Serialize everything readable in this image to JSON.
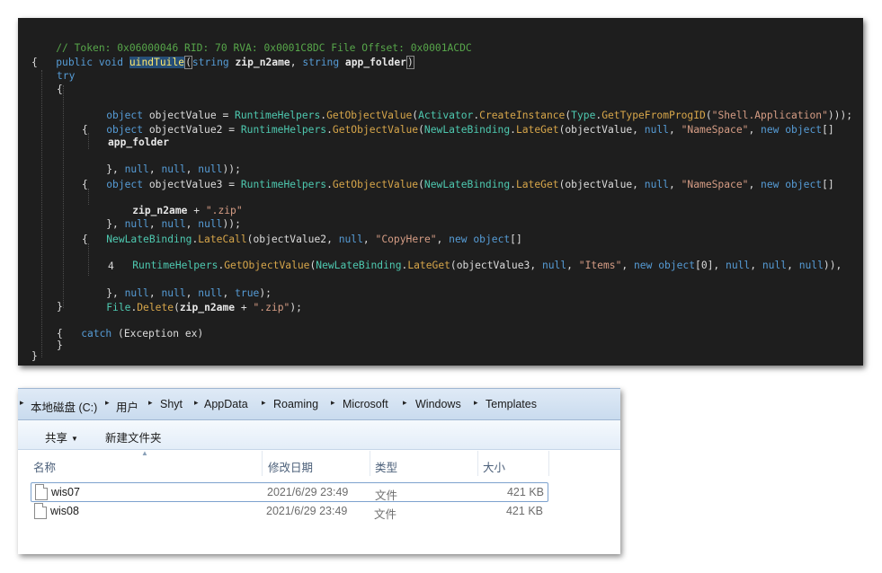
{
  "code": {
    "comment": "// Token: 0x06000046 RID: 70 RVA: 0x0001C8DC File Offset: 0x0001ACDC",
    "signature": {
      "mods": "public void ",
      "method_name": "uindTuile",
      "open_paren": "(",
      "p1_type": "string ",
      "p1_name": "zip_n2ame",
      "comma": ", ",
      "p2_type": "string ",
      "p2_name": "app_folder",
      "close_paren": ")"
    },
    "brace_open": "{",
    "brace_close": "}",
    "kw_try": "try",
    "kw_catch": "catch",
    "catch_rest": " (Exception ex)",
    "l1": {
      "a": "object ",
      "b": "objectValue = ",
      "c": "RuntimeHelpers",
      "d": ".",
      "e": "GetObjectValue",
      "f": "(",
      "g": "Activator",
      "h": ".",
      "i": "CreateInstance",
      "j": "(",
      "k": "Type",
      "l": ".",
      "m": "GetTypeFromProgID",
      "n": "(",
      "o": "\"Shell.Application\"",
      "p": ")));"
    },
    "l2": {
      "a": "object ",
      "b": "objectValue2 = ",
      "c": "RuntimeHelpers",
      "d": ".",
      "e": "GetObjectValue",
      "f": "(",
      "g": "NewLateBinding",
      "h": ".",
      "i": "LateGet",
      "j": "(objectValue, ",
      "k": "null",
      "l": ", ",
      "m": "\"NameSpace\"",
      "n": ", ",
      "o": "new object",
      "p": "[]"
    },
    "l3": "app_folder",
    "l4": {
      "a": "}, ",
      "b": "null",
      "c": ", ",
      "d": "null",
      "e": ", ",
      "f": "null",
      "g": "));"
    },
    "l5": {
      "a": "object ",
      "b": "objectValue3 = ",
      "c": "RuntimeHelpers",
      "d": ".",
      "e": "GetObjectValue",
      "f": "(",
      "g": "NewLateBinding",
      "h": ".",
      "i": "LateGet",
      "j": "(objectValue, ",
      "k": "null",
      "l": ", ",
      "m": "\"NameSpace\"",
      "n": ", ",
      "o": "new object",
      "p": "[]"
    },
    "l6": {
      "a": "zip_n2ame",
      "b": " + ",
      "c": "\".zip\""
    },
    "l7": {
      "a": "}, ",
      "b": "null",
      "c": ", ",
      "d": "null",
      "e": ", ",
      "f": "null",
      "g": "));"
    },
    "l8": {
      "a": "NewLateBinding",
      "b": ".",
      "c": "LateCall",
      "d": "(objectValue2, ",
      "e": "null",
      "f": ", ",
      "g": "\"CopyHere\"",
      "h": ", ",
      "i": "new object",
      "j": "[]"
    },
    "l9": {
      "a": "RuntimeHelpers",
      "b": ".",
      "c": "GetObjectValue",
      "d": "(",
      "e": "NewLateBinding",
      "f": ".",
      "g": "LateGet",
      "h": "(objectValue3, ",
      "i": "null",
      "j": ", ",
      "k": "\"Items\"",
      "l": ", ",
      "m": "new object",
      "n": "[0], ",
      "o": "null",
      "p": ", ",
      "q": "null",
      "r": ", ",
      "s": "null",
      "t": ")),"
    },
    "l10": "4",
    "l11": {
      "a": "}, ",
      "b": "null",
      "c": ", ",
      "d": "null",
      "e": ", ",
      "f": "null",
      "g": ", ",
      "h": "true",
      "i": ");"
    },
    "l12": {
      "a": "File",
      "b": ".",
      "c": "Delete",
      "d": "(",
      "e": "zip_n2ame",
      "f": " + ",
      "g": "\".zip\"",
      "h": ");"
    }
  },
  "explorer": {
    "breadcrumb": [
      "本地磁盘 (C:)",
      "用户",
      "Shyt",
      "AppData",
      "Roaming",
      "Microsoft",
      "Windows",
      "Templates"
    ],
    "breadcrumb_separator": "▸",
    "toolbar": {
      "share_label": "共享",
      "share_caret": "▼",
      "new_folder_label": "新建文件夹"
    },
    "sort_indicator": "▲",
    "columns": {
      "name": "名称",
      "date": "修改日期",
      "type": "类型",
      "size": "大小"
    },
    "files": [
      {
        "name": "wis07",
        "date": "2021/6/29 23:49",
        "type": "文件",
        "size": "421 KB"
      },
      {
        "name": "wis08",
        "date": "2021/6/29 23:49",
        "type": "文件",
        "size": "421 KB"
      }
    ]
  },
  "colors": {
    "code_bg": "#1e1e1e",
    "keyword": "#569cd6",
    "type": "#4ec9b0",
    "method": "#d7a64a",
    "string": "#d69d85",
    "comment": "#57a64a",
    "selection": "#264f78"
  }
}
